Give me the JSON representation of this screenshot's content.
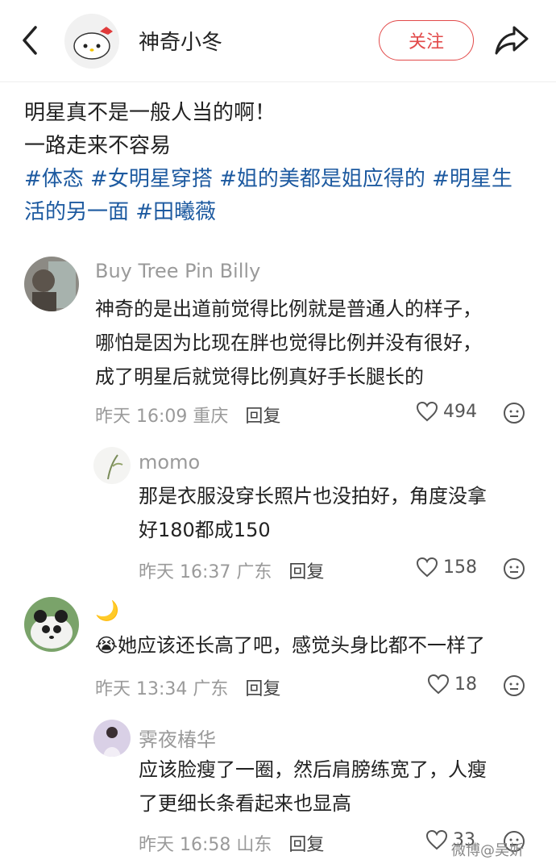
{
  "header": {
    "username": "神奇小冬",
    "follow_label": "关注"
  },
  "post": {
    "line1": "明星真不是一般人当的啊！",
    "line2": "一路走来不容易",
    "tags_line1": "#体态 #女明星穿搭 #姐的美都是姐应得的 #明星生",
    "tags_line2": "活的另一面 #田曦薇"
  },
  "comments": [
    {
      "name": "Buy Tree Pin Billy",
      "lines": [
        "神奇的是出道前觉得比例就是普通人的样子，",
        "哪怕是因为比现在胖也觉得比例并没有很好，",
        "成了明星后就觉得比例真好手长腿长的"
      ],
      "time": "昨天 16:09",
      "location": "重庆",
      "reply_label": "回复",
      "likes": "494"
    },
    {
      "name": "momo",
      "lines": [
        "那是衣服没穿长照片也没拍好，角度没拿",
        "好180都成150"
      ],
      "time": "昨天 16:37",
      "location": "广东",
      "reply_label": "回复",
      "likes": "158"
    },
    {
      "name": "🌙",
      "lines": [
        "她应该还长高了吧，感觉头身比都不一样了"
      ],
      "time": "昨天 13:34",
      "location": "广东",
      "reply_label": "回复",
      "likes": "18"
    },
    {
      "name": "霁夜椿华",
      "lines": [
        "应该脸瘦了一圈，然后肩膀练宽了，人瘦",
        "了更细长条看起来也显高"
      ],
      "time": "昨天 16:58",
      "location": "山东",
      "reply_label": "回复",
      "likes": "33"
    }
  ],
  "watermark": "微博@吴妡",
  "colors": {
    "accent_red": "#e24a4a",
    "tag_blue": "#1d5aa0",
    "meta_gray": "#9a9a9a"
  }
}
